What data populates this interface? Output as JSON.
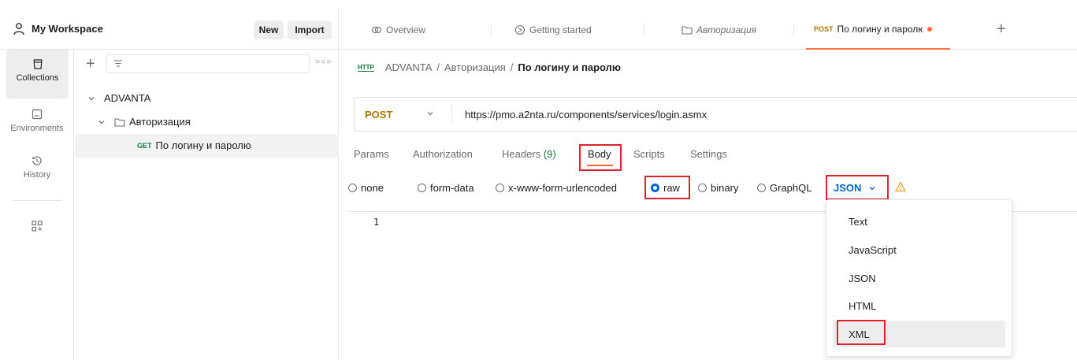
{
  "workspace": {
    "title": "My Workspace",
    "new_label": "New",
    "import_label": "Import"
  },
  "rail": {
    "items": [
      {
        "label": "Collections",
        "icon": "collections-icon"
      },
      {
        "label": "Environments",
        "icon": "environments-icon"
      },
      {
        "label": "History",
        "icon": "history-icon"
      }
    ]
  },
  "tree": {
    "collection": "ADVANTA",
    "folder": "Авторизация",
    "request_method": "GET",
    "request_name": "По логину и паролю"
  },
  "tabs": [
    {
      "label": "Overview",
      "icon": "overview-icon"
    },
    {
      "label": "Getting started",
      "icon": "getting-started-icon"
    },
    {
      "label": "Авторизация",
      "icon": "folder-icon"
    },
    {
      "method": "POST",
      "label": "По логину и паролю",
      "icon": "unsaved-dot"
    }
  ],
  "breadcrumb": {
    "icon_text": "HTTP",
    "part1": "ADVANTA",
    "sep": "/",
    "part2": "Авторизация",
    "current": "По логину и паролю"
  },
  "request": {
    "method": "POST",
    "url": "https://pmo.a2nta.ru/components/services/login.asmx"
  },
  "subtabs": {
    "params": "Params",
    "authorization": "Authorization",
    "headers": "Headers",
    "headers_count": "(9)",
    "body": "Body",
    "scripts": "Scripts",
    "settings": "Settings"
  },
  "body_options": {
    "none": "none",
    "form_data": "form-data",
    "urlencoded": "x-www-form-urlencoded",
    "raw": "raw",
    "binary": "binary",
    "graphql": "GraphQL",
    "selected_type": "JSON"
  },
  "editor": {
    "line1": "1"
  },
  "dropdown": {
    "items": [
      "Text",
      "JavaScript",
      "JSON",
      "HTML",
      "XML"
    ]
  },
  "colors": {
    "accent": "#ff6c37",
    "post": "#ad7a03",
    "get": "#0f7a3c",
    "link_blue": "#0265d2",
    "highlight_red": "#e0212f"
  }
}
